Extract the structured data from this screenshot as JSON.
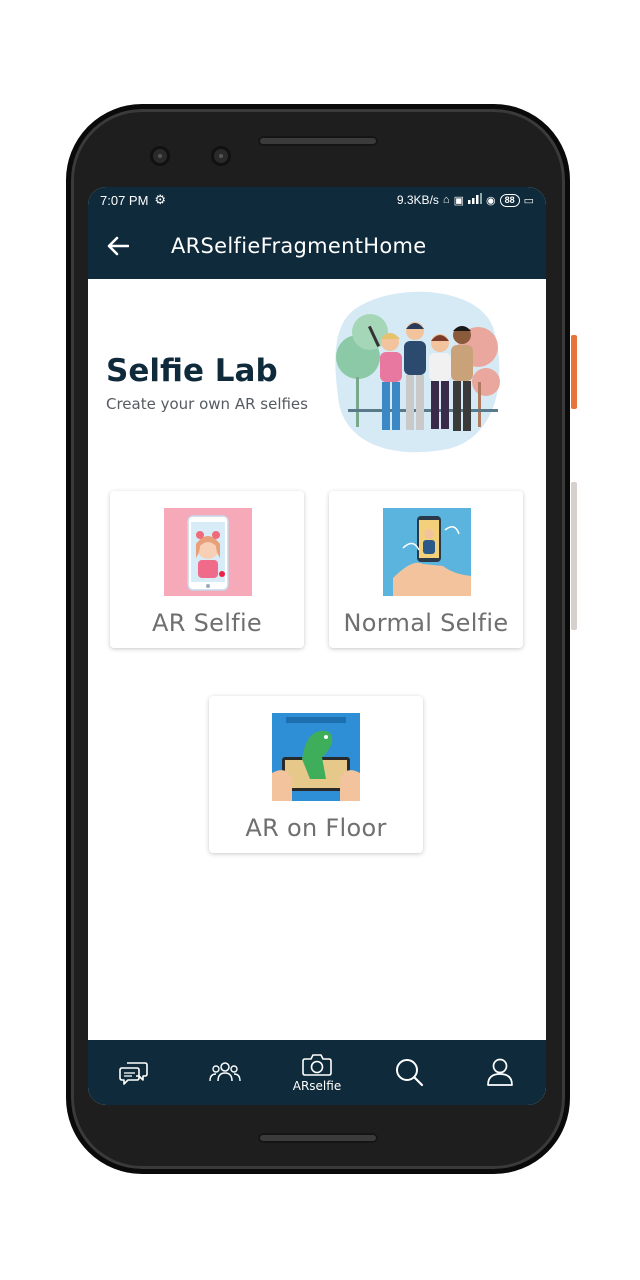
{
  "statusbar": {
    "time": "7:07 PM",
    "network_speed": "9.3KB/s",
    "battery": "88"
  },
  "appbar": {
    "title": "ARSelfieFragmentHome"
  },
  "hero": {
    "title": "Selfie Lab",
    "subtitle": "Create your own AR selfies"
  },
  "cards": [
    {
      "label": "AR Selfie"
    },
    {
      "label": "Normal Selfie"
    },
    {
      "label": "AR on Floor"
    }
  ],
  "bottom_nav": {
    "items": [
      {
        "icon": "chat-icon",
        "label": ""
      },
      {
        "icon": "group-icon",
        "label": ""
      },
      {
        "icon": "camera-icon",
        "label": "ARselfie"
      },
      {
        "icon": "search-icon",
        "label": ""
      },
      {
        "icon": "profile-icon",
        "label": ""
      }
    ]
  },
  "colors": {
    "primary_dark": "#0e2a3b",
    "card_label": "#6f6f6f",
    "hero_title": "#0e2a3b"
  }
}
